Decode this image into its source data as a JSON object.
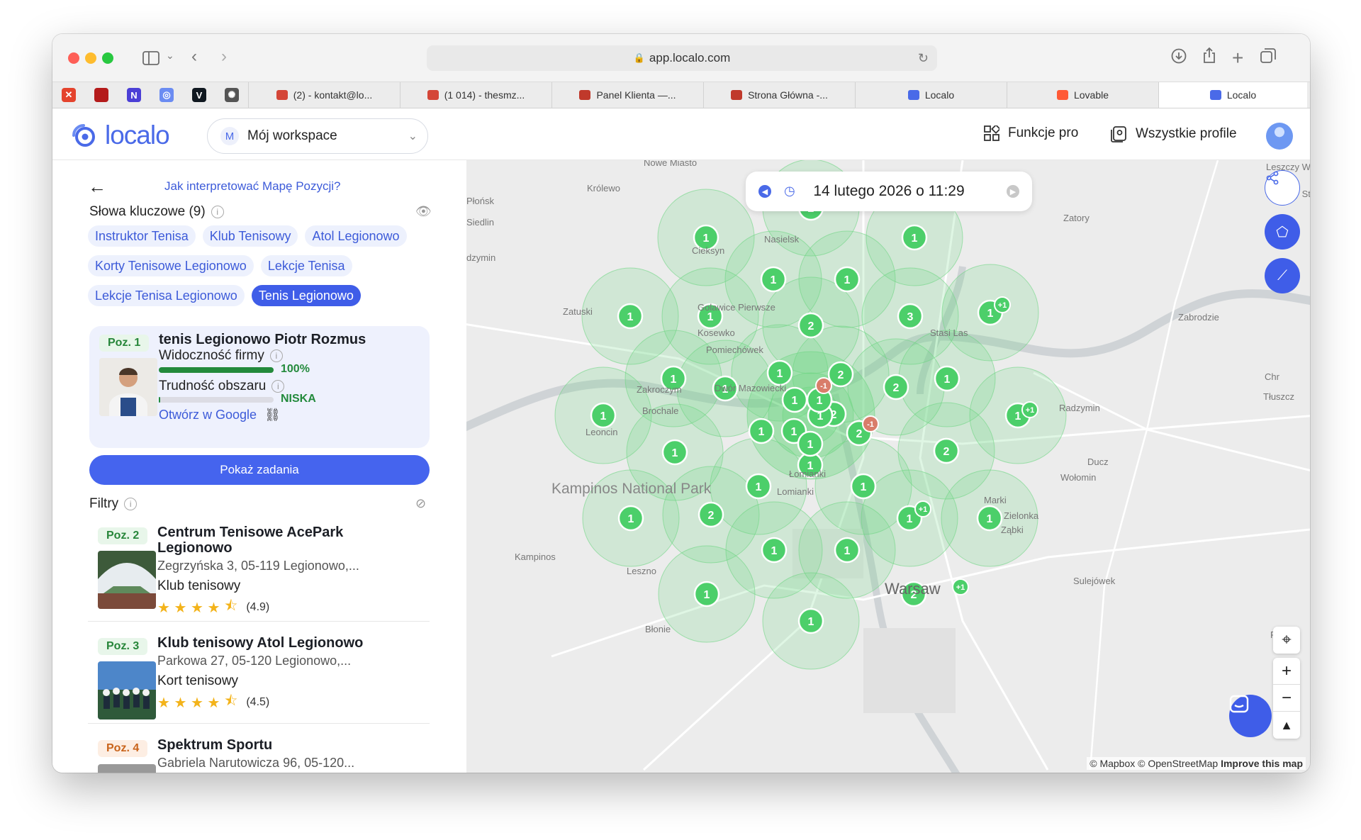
{
  "browser": {
    "url": "app.localo.com",
    "tabs": [
      {
        "label": "(2) - kontakt@lo...",
        "icon_color": "#d44638"
      },
      {
        "label": "(1 014) - thesmz...",
        "icon_color": "#d44638"
      },
      {
        "label": "Panel Klienta —...",
        "icon_color": "#c0392b"
      },
      {
        "label": "Strona Główna -...",
        "icon_color": "#c0392b"
      },
      {
        "label": "Localo",
        "icon_color": "#4a6ae8"
      },
      {
        "label": "Lovable",
        "icon_color": "#ff5a36"
      },
      {
        "label": "Localo",
        "icon_color": "#4a6ae8"
      }
    ],
    "pinned_tabs": [
      {
        "icon": "x-icon",
        "text": "✕",
        "color": "#e4432d"
      },
      {
        "icon": "red-app-icon",
        "text": "",
        "color": "#b41b1b"
      },
      {
        "icon": "n-app-icon",
        "text": "N",
        "color": "#4b3fd6"
      },
      {
        "icon": "localo-pin-icon",
        "text": "◎",
        "color": "#6b8cf2"
      },
      {
        "icon": "v-app-icon",
        "text": "V",
        "color": "#101820"
      },
      {
        "icon": "openai-icon",
        "text": "✺",
        "color": "#555555"
      }
    ]
  },
  "app": {
    "logo_text": "localo",
    "workspace": {
      "badge": "M",
      "label": "Mój workspace"
    },
    "funkcje_pro": "Funkcje pro",
    "wszystkie_profile": "Wszystkie profile",
    "brand_color": "#4a6ae8"
  },
  "sidebar": {
    "help_link": "Jak interpretować Mapę Pozycji?",
    "keywords_title": "Słowa kluczowe (9)",
    "keywords": [
      {
        "label": "Instruktor Tenisa",
        "selected": false
      },
      {
        "label": "Klub Tenisowy",
        "selected": false
      },
      {
        "label": "Atol Legionowo",
        "selected": false
      },
      {
        "label": "Korty Tenisowe Legionowo",
        "selected": false
      },
      {
        "label": "Lekcje Tenisa",
        "selected": false
      },
      {
        "label": "Lekcje Tenisa Legionowo",
        "selected": false
      },
      {
        "label": "Tenis Legionowo",
        "selected": true
      }
    ],
    "top_result": {
      "position": "Poz. 1",
      "name": "tenis Legionowo Piotr Rozmus",
      "visibility_label": "Widoczność firmy",
      "visibility_value": "100%",
      "visibility_fraction": 1.0,
      "difficulty_label": "Trudność obszaru",
      "difficulty_value": "NISKA",
      "difficulty_fraction": 0.01,
      "open_google": "Otwórz w Google"
    },
    "show_tasks": "Pokaż zadania",
    "filters_title": "Filtry",
    "results": [
      {
        "position": "Poz. 2",
        "name": "Centrum Tenisowe AcePark Legionowo",
        "address": "Zegrzyńska 3, 05-119 Legionowo,...",
        "category": "Klub tenisowy",
        "rating": "(4.9)"
      },
      {
        "position": "Poz. 3",
        "name": "Klub tenisowy Atol Legionowo",
        "address": "Parkowa 27, 05-120 Legionowo,...",
        "category": "Kort tenisowy",
        "rating": "(4.5)"
      },
      {
        "position": "Poz. 4",
        "name": "Spektrum Sportu",
        "address": "Gabriela Narutowicza 96, 05-120...",
        "category": "",
        "rating": ""
      }
    ]
  },
  "map": {
    "date": "14 lutego 2026 o 11:29",
    "attribution_1": "© Mapbox",
    "attribution_2": "© OpenStreetMap",
    "attribution_3": "Improve this map",
    "pin_color": "#4ccf6a",
    "circle_color": "#6fd684",
    "pins": [
      "1",
      "2",
      "1",
      "1",
      "1",
      "1",
      "2",
      "3",
      "1",
      "1",
      "1",
      "1",
      "1",
      "2",
      "2",
      "1",
      "1",
      "1",
      "2",
      "2",
      "1",
      "1",
      "1",
      "2",
      "2",
      "1",
      "1",
      "1",
      "1",
      "1",
      "2",
      "1",
      "1",
      "1",
      "1",
      "1",
      "1",
      "1",
      "2",
      "2",
      "1",
      "1"
    ],
    "badges": [
      "+1",
      "+1",
      "+1",
      "+1",
      "-1",
      "-1"
    ],
    "places": [
      "Nowe Miasto",
      "Królewo",
      "Płońsk",
      "Siedlin",
      "Cieksyn",
      "Nasielsk",
      "Zatory",
      "Leszczy Wólk",
      "Leszczy Stary",
      "dzymin",
      "Zatuski",
      "Golawice Pierwsze",
      "Kosewko",
      "Pomiechówek",
      "Stasi Las",
      "Zabrodzie",
      "Zakroczym",
      "Dwór Mazowiecki",
      "Brochale",
      "Leoncin",
      "Radzymin",
      "Tłuszcz",
      "Chr",
      "Ducz",
      "Kampinos National Park",
      "Łomianki",
      "Lomianki",
      "Wołomin",
      "Marki",
      "Zielonka",
      "Ząbki",
      "Kampinos",
      "Leszno",
      "Warsaw",
      "Sulejówek",
      "Błonie",
      "Rud"
    ]
  }
}
